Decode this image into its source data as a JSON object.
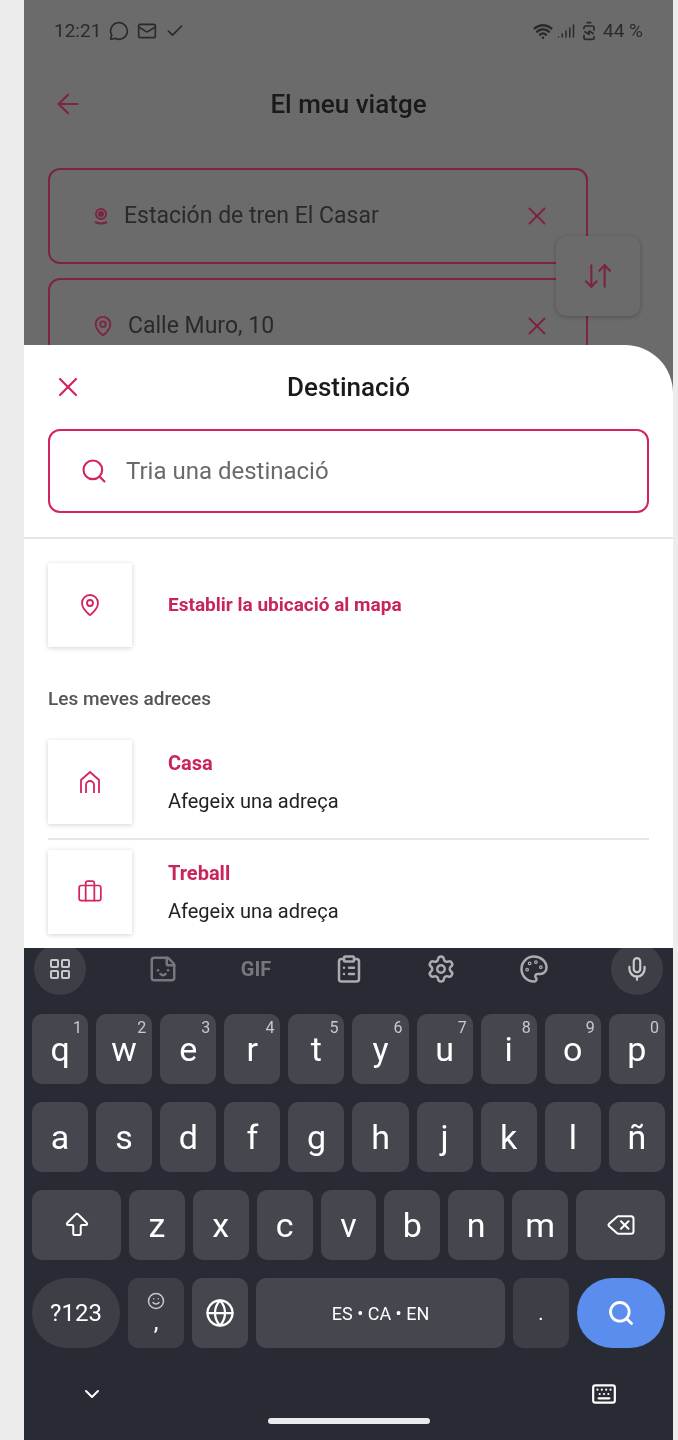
{
  "status_bar": {
    "time": "12:21",
    "battery": "44 %"
  },
  "header": {
    "title": "El meu viatge"
  },
  "trip_fields": [
    {
      "kind": "origin",
      "text": "Estación de tren El Casar"
    },
    {
      "kind": "destination",
      "text": "Calle Muro, 10"
    }
  ],
  "sheet": {
    "title": "Destinació",
    "search": {
      "placeholder": "Tria una destinació"
    },
    "map_option": "Establir la ubicació al mapa",
    "section": "Les meves adreces",
    "addresses": [
      {
        "kind": "home",
        "name": "Casa",
        "detail": "Afegeix una adreça"
      },
      {
        "kind": "work",
        "name": "Treball",
        "detail": "Afegeix una adreça"
      }
    ]
  },
  "keyboard": {
    "gif": "GIF",
    "rows": [
      [
        {
          "label": "q",
          "hint": "1"
        },
        {
          "label": "w",
          "hint": "2"
        },
        {
          "label": "e",
          "hint": "3"
        },
        {
          "label": "r",
          "hint": "4"
        },
        {
          "label": "t",
          "hint": "5"
        },
        {
          "label": "y",
          "hint": "6"
        },
        {
          "label": "u",
          "hint": "7"
        },
        {
          "label": "i",
          "hint": "8"
        },
        {
          "label": "o",
          "hint": "9"
        },
        {
          "label": "p",
          "hint": "0"
        }
      ],
      [
        {
          "label": "a"
        },
        {
          "label": "s"
        },
        {
          "label": "d"
        },
        {
          "label": "f"
        },
        {
          "label": "g"
        },
        {
          "label": "h"
        },
        {
          "label": "j"
        },
        {
          "label": "k"
        },
        {
          "label": "l"
        },
        {
          "label": "ñ"
        }
      ],
      [
        {
          "label": "z"
        },
        {
          "label": "x"
        },
        {
          "label": "c"
        },
        {
          "label": "v"
        },
        {
          "label": "b"
        },
        {
          "label": "n"
        },
        {
          "label": "m"
        }
      ]
    ],
    "symbols": "?123",
    "comma": ",",
    "space": "ES • CA • EN",
    "period": "."
  }
}
